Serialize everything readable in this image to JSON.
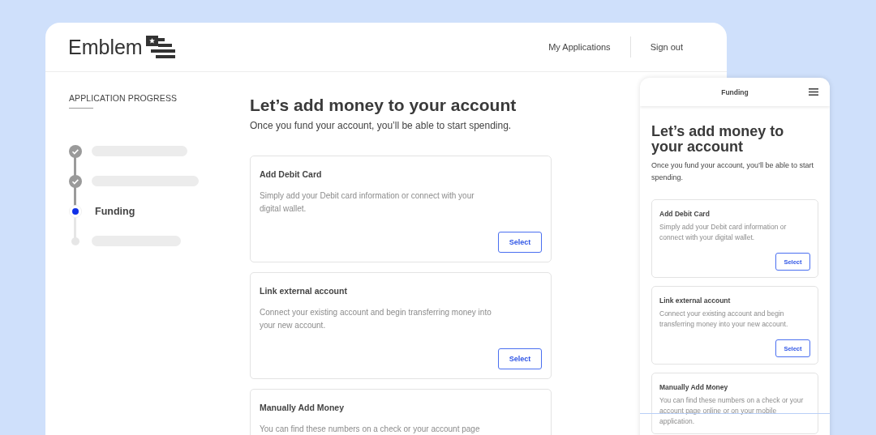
{
  "desktop": {
    "logo": "Emblem",
    "nav": [
      "My Applications",
      "Sign out"
    ],
    "progress": {
      "title": "APPLICATION PROGRESS",
      "steps": [
        {
          "checked": true,
          "selected": false
        },
        {
          "checked": true,
          "selected": false
        },
        {
          "checked": false,
          "selected": true,
          "label": "Funding"
        },
        {
          "checked": false,
          "selected": false
        }
      ]
    },
    "heading": "Let’s add money to your account",
    "subheading": "Once you fund your account, you’ll be able to start spending.",
    "options": [
      {
        "title": "Add Debit Card",
        "description": "Simply add your Debit card information or connect with your digital wallet.",
        "button": "Select"
      },
      {
        "title": "Link external account",
        "description": "Connect your existing account and begin transferring money into your new account.",
        "button": "Select"
      },
      {
        "title": "Manually Add Money",
        "description": "You can find these numbers on a check or your account page"
      }
    ]
  },
  "mobile": {
    "title": "Funding",
    "heading": "Let’s add money to your account",
    "subheading": "Once you fund your account, you’ll be able to start spending.",
    "options": [
      {
        "title": "Add Debit Card",
        "description": "Simply add your Debit card information or connect with your digital wallet.",
        "button": "Select"
      },
      {
        "title": "Link external account",
        "description": "Connect your existing account and begin transferring money into your new account.",
        "button": "Select"
      },
      {
        "title": "Manually Add Money",
        "description": "You can find these numbers on a check or your account page online or on your mobile application."
      }
    ]
  }
}
